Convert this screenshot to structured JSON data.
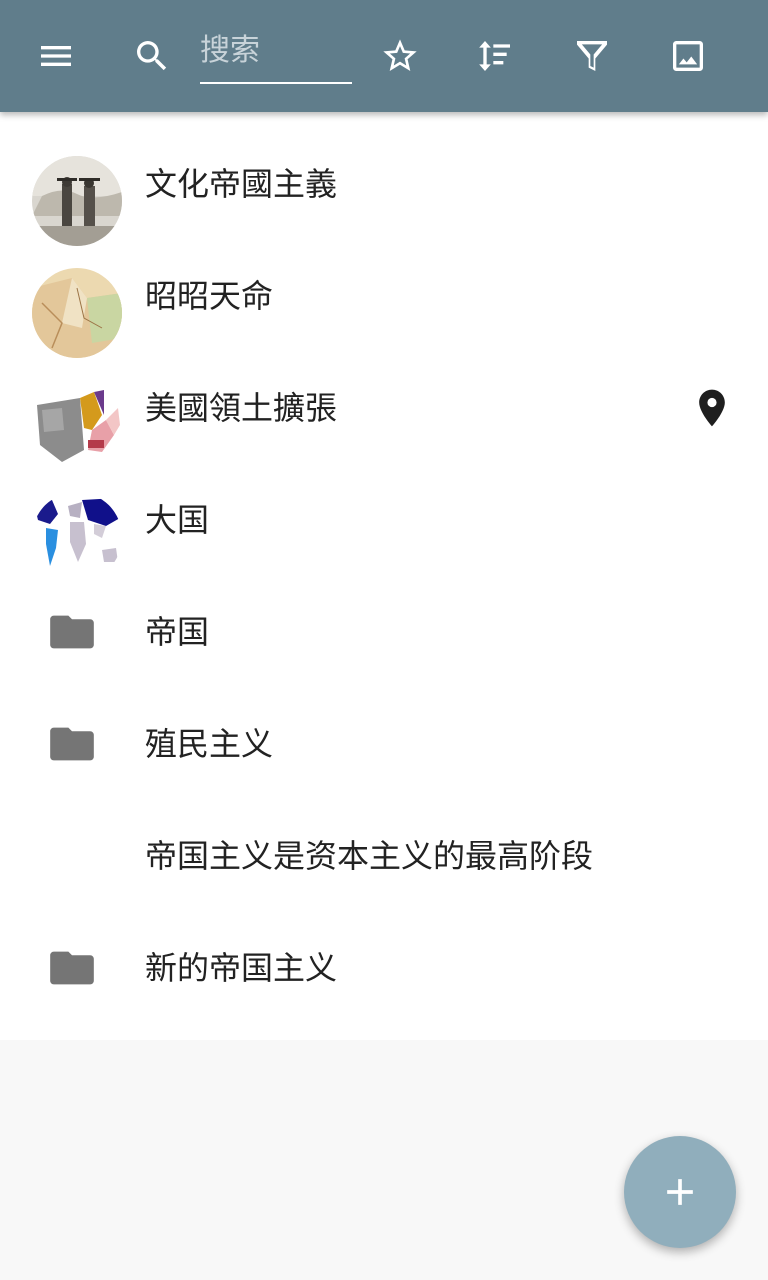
{
  "toolbar": {
    "background": "#607d8b",
    "icons": {
      "menu": "menu-icon",
      "search": "search-icon",
      "favorite": "star-outline-icon",
      "sort": "sort-icon",
      "filter": "filter-icon",
      "image": "image-icon"
    },
    "search_placeholder": "搜索",
    "search_value": ""
  },
  "list": {
    "items": [
      {
        "label": "文化帝國主義",
        "icon": "thumbnail-engraving"
      },
      {
        "label": "昭昭天命",
        "icon": "thumbnail-old-map"
      },
      {
        "label": "美國領土擴張",
        "icon": "thumbnail-us-map",
        "trailing_icon": "map-pin-icon"
      },
      {
        "label": "大国",
        "icon": "thumbnail-world-map"
      },
      {
        "label": "帝国",
        "icon": "folder-icon"
      },
      {
        "label": "殖民主义",
        "icon": "folder-icon"
      },
      {
        "label": "帝国主义是资本主义的最高阶段",
        "icon": ""
      },
      {
        "label": "新的帝国主义",
        "icon": "folder-icon"
      }
    ]
  },
  "fab": {
    "icon": "plus-icon",
    "color": "#90aebc"
  }
}
